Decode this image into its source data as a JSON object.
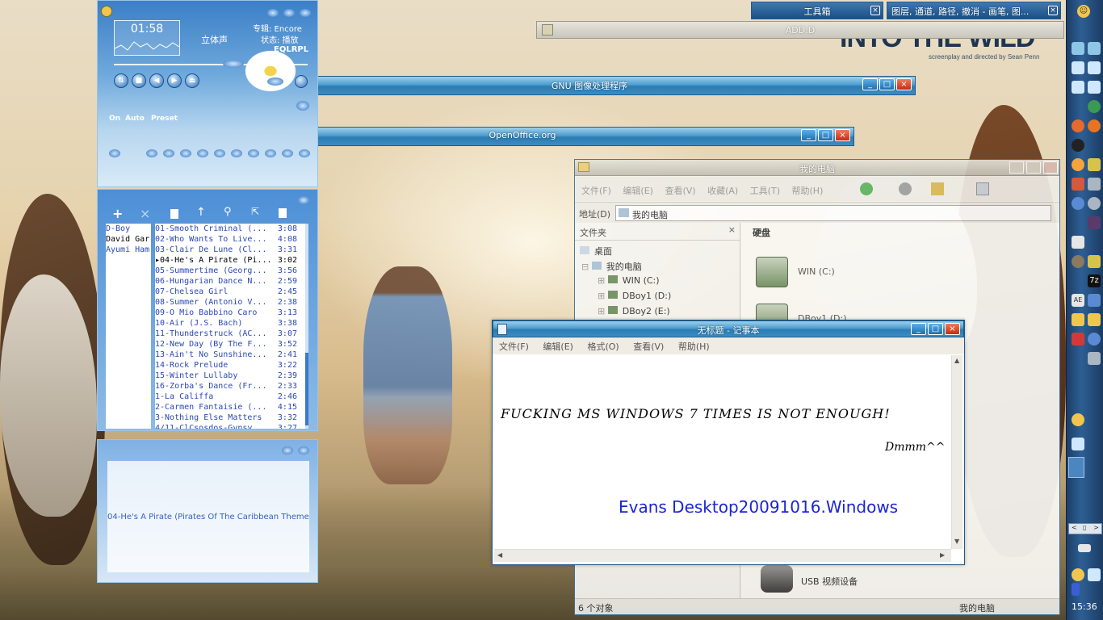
{
  "desktop": {
    "title": "INTO THE WILD",
    "subtitle": "screenplay and directed by Sean Penn"
  },
  "toolbox": {
    "title": "工具箱"
  },
  "layers": {
    "title": "图层, 通道, 路径, 撤消 - 画笔, 图..."
  },
  "add_window": {
    "title": "ADD.D"
  },
  "gimp": {
    "title": "GNU 图像处理程序"
  },
  "openoffice": {
    "title": "OpenOffice.org"
  },
  "player": {
    "time": "01:58",
    "mode": "立体声",
    "album": "专辑: Encore",
    "state": "状态: 播放",
    "eq_labels": "EQLRPL",
    "eq_buttons": [
      "On",
      "Auto",
      "Preset"
    ],
    "artists": [
      "D-Boy",
      "David Gar",
      "Ayumi Ham"
    ],
    "tracks": [
      {
        "name": "01-Smooth Criminal (...",
        "dur": "3:08"
      },
      {
        "name": "02-Who Wants To Live...",
        "dur": "4:08"
      },
      {
        "name": "03-Clair De Lune (Cl...",
        "dur": "3:31"
      },
      {
        "name": "▸04-He's A Pirate (Pi...",
        "dur": "3:02"
      },
      {
        "name": "05-Summertime (Georg...",
        "dur": "3:56"
      },
      {
        "name": "06-Hungarian Dance N...",
        "dur": "2:59"
      },
      {
        "name": "07-Chelsea Girl",
        "dur": "2:45"
      },
      {
        "name": "08-Summer (Antonio V...",
        "dur": "2:38"
      },
      {
        "name": "09-O Mio Babbino Caro",
        "dur": "3:13"
      },
      {
        "name": "10-Air (J.S. Bach)",
        "dur": "3:38"
      },
      {
        "name": "11-Thunderstruck (AC...",
        "dur": "3:07"
      },
      {
        "name": "12-New Day (By The F...",
        "dur": "3:52"
      },
      {
        "name": "13-Ain't No Sunshine...",
        "dur": "2:41"
      },
      {
        "name": "14-Rock Prelude",
        "dur": "3:22"
      },
      {
        "name": "15-Winter Lullaby",
        "dur": "2:39"
      },
      {
        "name": "16-Zorba's Dance (Fr...",
        "dur": "2:33"
      },
      {
        "name": "1-La Califfa",
        "dur": "2:46"
      },
      {
        "name": "2-Carmen Fantaisie (...",
        "dur": "4:15"
      },
      {
        "name": "3-Nothing Else Matters",
        "dur": "3:32"
      },
      {
        "name": "4/11-ClCsosdos-Gynsy...",
        "dur": "3:27"
      }
    ],
    "now_playing": "04-He's A Pirate (Pirates Of The Caribbean Theme)"
  },
  "explorer": {
    "title": "我的电脑",
    "menu": [
      "文件(F)",
      "编辑(E)",
      "查看(V)",
      "收藏(A)",
      "工具(T)",
      "帮助(H)"
    ],
    "address_label": "地址(D)",
    "address_value": "我的电脑",
    "folders_label": "文件夹",
    "tree": [
      "桌面",
      "我的电脑",
      "WIN (C:)",
      "DBoy1 (D:)",
      "DBoy2 (E:)"
    ],
    "section": "硬盘",
    "drives": [
      "WIN (C:)",
      "DBoy1 (D:)"
    ],
    "usb": "USB 视频设备",
    "status_count": "6 个对象",
    "status_location": "我的电脑"
  },
  "notepad": {
    "title": "无标题 - 记事本",
    "menu": [
      "文件(F)",
      "编辑(E)",
      "格式(O)",
      "查看(V)",
      "帮助(H)"
    ],
    "line1": "FUCKING MS WINDOWS 7 TIMES IS NOT ENOUGH!",
    "line2": "Dmmm^^",
    "line3": "Evans Desktop20091016.Windows"
  },
  "taskbar": {
    "clock": "15:36"
  }
}
